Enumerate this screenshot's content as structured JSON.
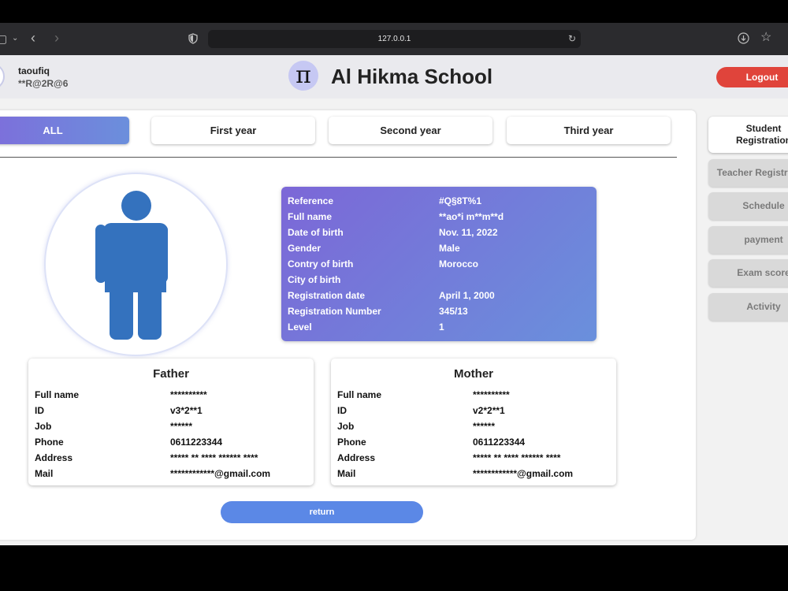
{
  "browser": {
    "url": "127.0.0.1",
    "icons": [
      "sidebar-icon",
      "chevron-down-icon",
      "back-icon",
      "forward-icon",
      "shield-icon",
      "reload-icon",
      "download-icon",
      "bookmark-star-icon"
    ]
  },
  "header": {
    "username": "taoufiq",
    "password": "**R@2R@6",
    "logo_symbol": "π",
    "school_name": "Al Hikma School",
    "logout_label": "Logout"
  },
  "tabs": [
    "ALL",
    "First year",
    "Second year",
    "Third year"
  ],
  "student": {
    "rows": [
      {
        "label": "Reference",
        "value": "#Q§8T%1"
      },
      {
        "label": "Full name",
        "value": "**ao*i m**m**d"
      },
      {
        "label": "Date of birth",
        "value": "Nov. 11, 2022"
      },
      {
        "label": "Gender",
        "value": "Male"
      },
      {
        "label": "Contry of birth",
        "value": "Morocco"
      },
      {
        "label": "City of birth",
        "value": ""
      },
      {
        "label": "Registration date",
        "value": "April 1, 2000"
      },
      {
        "label": "Registration Number",
        "value": "345/13"
      },
      {
        "label": "Level",
        "value": "1"
      }
    ]
  },
  "father": {
    "title": "Father",
    "rows": [
      {
        "label": "Full name",
        "value": "**********"
      },
      {
        "label": "ID",
        "value": "v3*2**1"
      },
      {
        "label": "Job",
        "value": "******"
      },
      {
        "label": "Phone",
        "value": "0611223344"
      },
      {
        "label": "Address",
        "value": "***** ** **** ****** ****"
      },
      {
        "label": "Mail",
        "value": "************@gmail.com"
      }
    ]
  },
  "mother": {
    "title": "Mother",
    "rows": [
      {
        "label": "Full name",
        "value": "**********"
      },
      {
        "label": "ID",
        "value": "v2*2**1"
      },
      {
        "label": "Job",
        "value": "******"
      },
      {
        "label": "Phone",
        "value": "0611223344"
      },
      {
        "label": "Address",
        "value": "***** ** **** ****** ****"
      },
      {
        "label": "Mail",
        "value": "************@gmail.com"
      }
    ]
  },
  "return_label": "return",
  "side_menu": {
    "active": {
      "line1": "Student",
      "line2": "Registration"
    },
    "items": [
      "Teacher Registration",
      "Schedule",
      "payment",
      "Exam score",
      "Activity"
    ]
  },
  "colors": {
    "accent_gradient_start": "#7f6bdb",
    "accent_gradient_end": "#6b8fdc",
    "logout": "#e0443b",
    "return_button": "#5b88e6",
    "person_icon": "#3472be"
  }
}
